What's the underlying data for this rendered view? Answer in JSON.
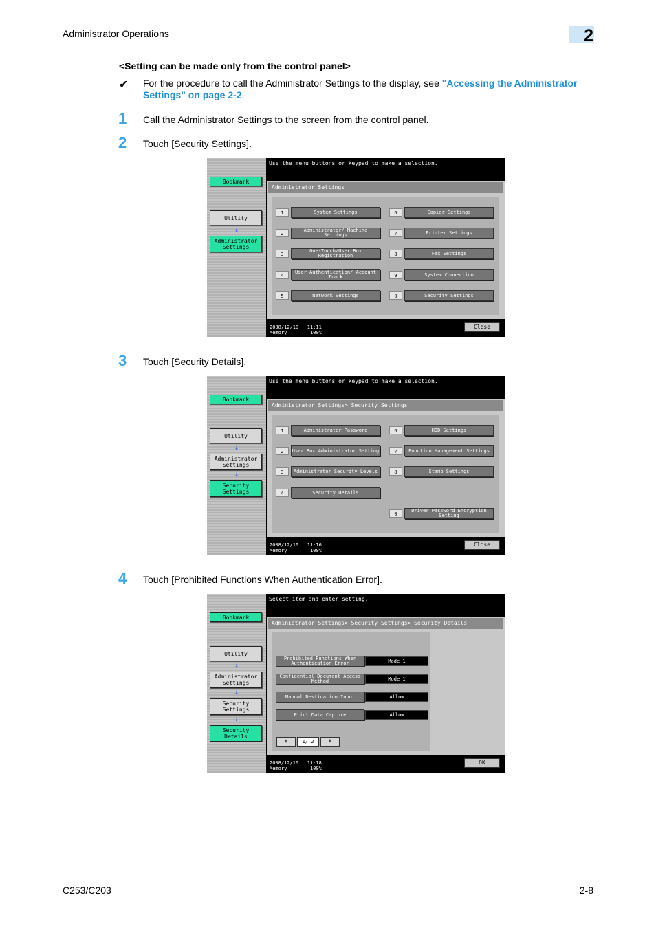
{
  "header": {
    "title": "Administrator Operations",
    "chapter": "2"
  },
  "subheading": "<Setting can be made only from the control panel>",
  "note": {
    "mark": "✔",
    "text_before": "For the procedure to call the Administrator Settings to the display, see ",
    "link": "\"Accessing the Administrator Settings\" on page 2-2",
    "text_after": "."
  },
  "steps": [
    {
      "num": "1",
      "text": "Call the Administrator Settings to the screen from the control panel."
    },
    {
      "num": "2",
      "text": "Touch [Security Settings]."
    },
    {
      "num": "3",
      "text": "Touch [Security Details]."
    },
    {
      "num": "4",
      "text": "Touch [Prohibited Functions When Authentication Error]."
    }
  ],
  "screen1": {
    "message": "Use the menu buttons or keypad to make a selection.",
    "left": {
      "bookmark": "Bookmark",
      "utility": "Utility",
      "admin": "Administrator Settings",
      "arrow": "↓"
    },
    "title": "Administrator Settings",
    "items": [
      {
        "num": "1",
        "label": "System Settings"
      },
      {
        "num": "2",
        "label": "Administrator/ Machine Settings"
      },
      {
        "num": "3",
        "label": "One-Touch/User Box Registration"
      },
      {
        "num": "4",
        "label": "User Authentication/ Account Track"
      },
      {
        "num": "5",
        "label": "Network Settings"
      },
      {
        "num": "6",
        "label": "Copier Settings"
      },
      {
        "num": "7",
        "label": "Printer Settings"
      },
      {
        "num": "8",
        "label": "Fax Settings"
      },
      {
        "num": "9",
        "label": "System Connection"
      },
      {
        "num": "0",
        "label": "Security Settings"
      }
    ],
    "datetime": "2008/12/10   11:11\nMemory        100%",
    "close": "Close"
  },
  "screen2": {
    "message": "Use the menu buttons or keypad to make a selection.",
    "left": {
      "bookmark": "Bookmark",
      "utility": "Utility",
      "admin": "Administrator Settings",
      "security": "Security Settings",
      "arrow": "↓"
    },
    "title": "Administrator Settings> Security Settings",
    "items": [
      {
        "num": "1",
        "label": "Administrator Password"
      },
      {
        "num": "2",
        "label": "User Box Administrator Setting"
      },
      {
        "num": "3",
        "label": "Administrator Security Levels"
      },
      {
        "num": "4",
        "label": "Security Details"
      },
      {
        "num": "6",
        "label": "HDD Settings"
      },
      {
        "num": "7",
        "label": "Function Management Settings"
      },
      {
        "num": "8",
        "label": "Stamp Settings"
      },
      {
        "num": "0",
        "label": "Driver Password Encryption Setting"
      }
    ],
    "datetime": "2008/12/10   11:16\nMemory        100%",
    "close": "Close"
  },
  "screen3": {
    "message": "Select item and enter setting.",
    "left": {
      "bookmark": "Bookmark",
      "utility": "Utility",
      "admin": "Administrator Settings",
      "security": "Security Settings",
      "details": "Security Details",
      "arrow": "↓"
    },
    "title": "Administrator Settings> Security Settings> Security Details",
    "rows": [
      {
        "label": "Prohibited Functions When Authentication Error",
        "value": "Mode 1"
      },
      {
        "label": "Confidential Document Access Method",
        "value": "Mode 1"
      },
      {
        "label": "Manual Destination Input",
        "value": "Allow"
      },
      {
        "label": "Print Data Capture",
        "value": "Allow"
      }
    ],
    "pager": "1/ 2",
    "datetime": "2008/12/10   11:18\nMemory        100%",
    "ok": "OK"
  },
  "footer": {
    "model": "C253/C203",
    "page": "2-8"
  }
}
